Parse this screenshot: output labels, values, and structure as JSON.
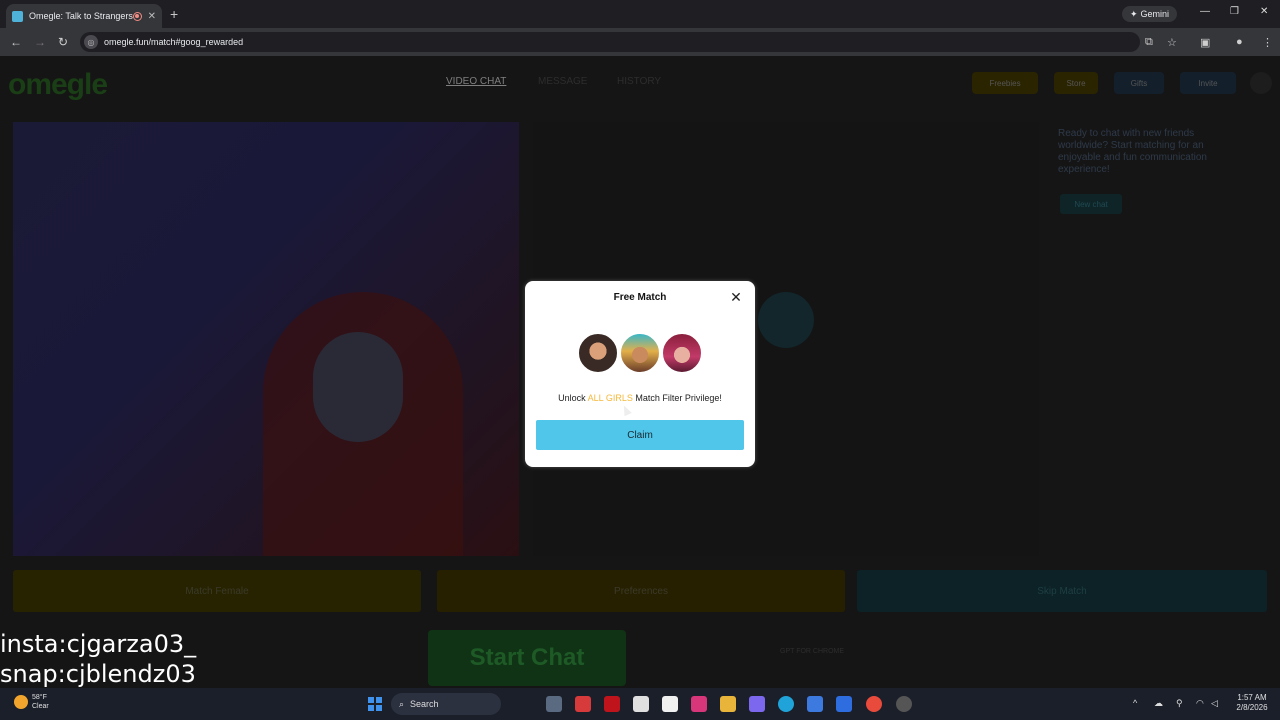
{
  "browser": {
    "tab_title": "Omegle: Talk to Strangers o",
    "gemini_label": "Gemini",
    "url": "omegle.fun/match#goog_rewarded"
  },
  "site": {
    "logo": "omegle",
    "nav": [
      "VIDEO CHAT",
      "MESSAGE",
      "HISTORY"
    ],
    "top_buttons": [
      "Freebies",
      "Store",
      "Gifts",
      "Invite"
    ],
    "side_text": "Ready to chat with new friends worldwide? Start matching for an enjoyable and fun communication experience!",
    "new_chat": "New chat",
    "bottom_buttons": [
      "Match Female",
      "Preferences",
      "Skip Match"
    ],
    "start_chat": "Start Chat",
    "ad_text": "GPT FOR CHROME"
  },
  "modal": {
    "title": "Free Match",
    "unlock_prefix": "Unlock ",
    "unlock_highlight": "ALL GIRLS",
    "unlock_suffix": " Match Filter Privilege!",
    "claim_label": "Claim"
  },
  "overlay": {
    "insta": "insta:cjgarza03_",
    "snap": "snap:cjblendz03"
  },
  "taskbar": {
    "temp": "58°F",
    "condition": "Clear",
    "search": "Search",
    "time": "1:57 AM",
    "date": "2/8/2026"
  }
}
